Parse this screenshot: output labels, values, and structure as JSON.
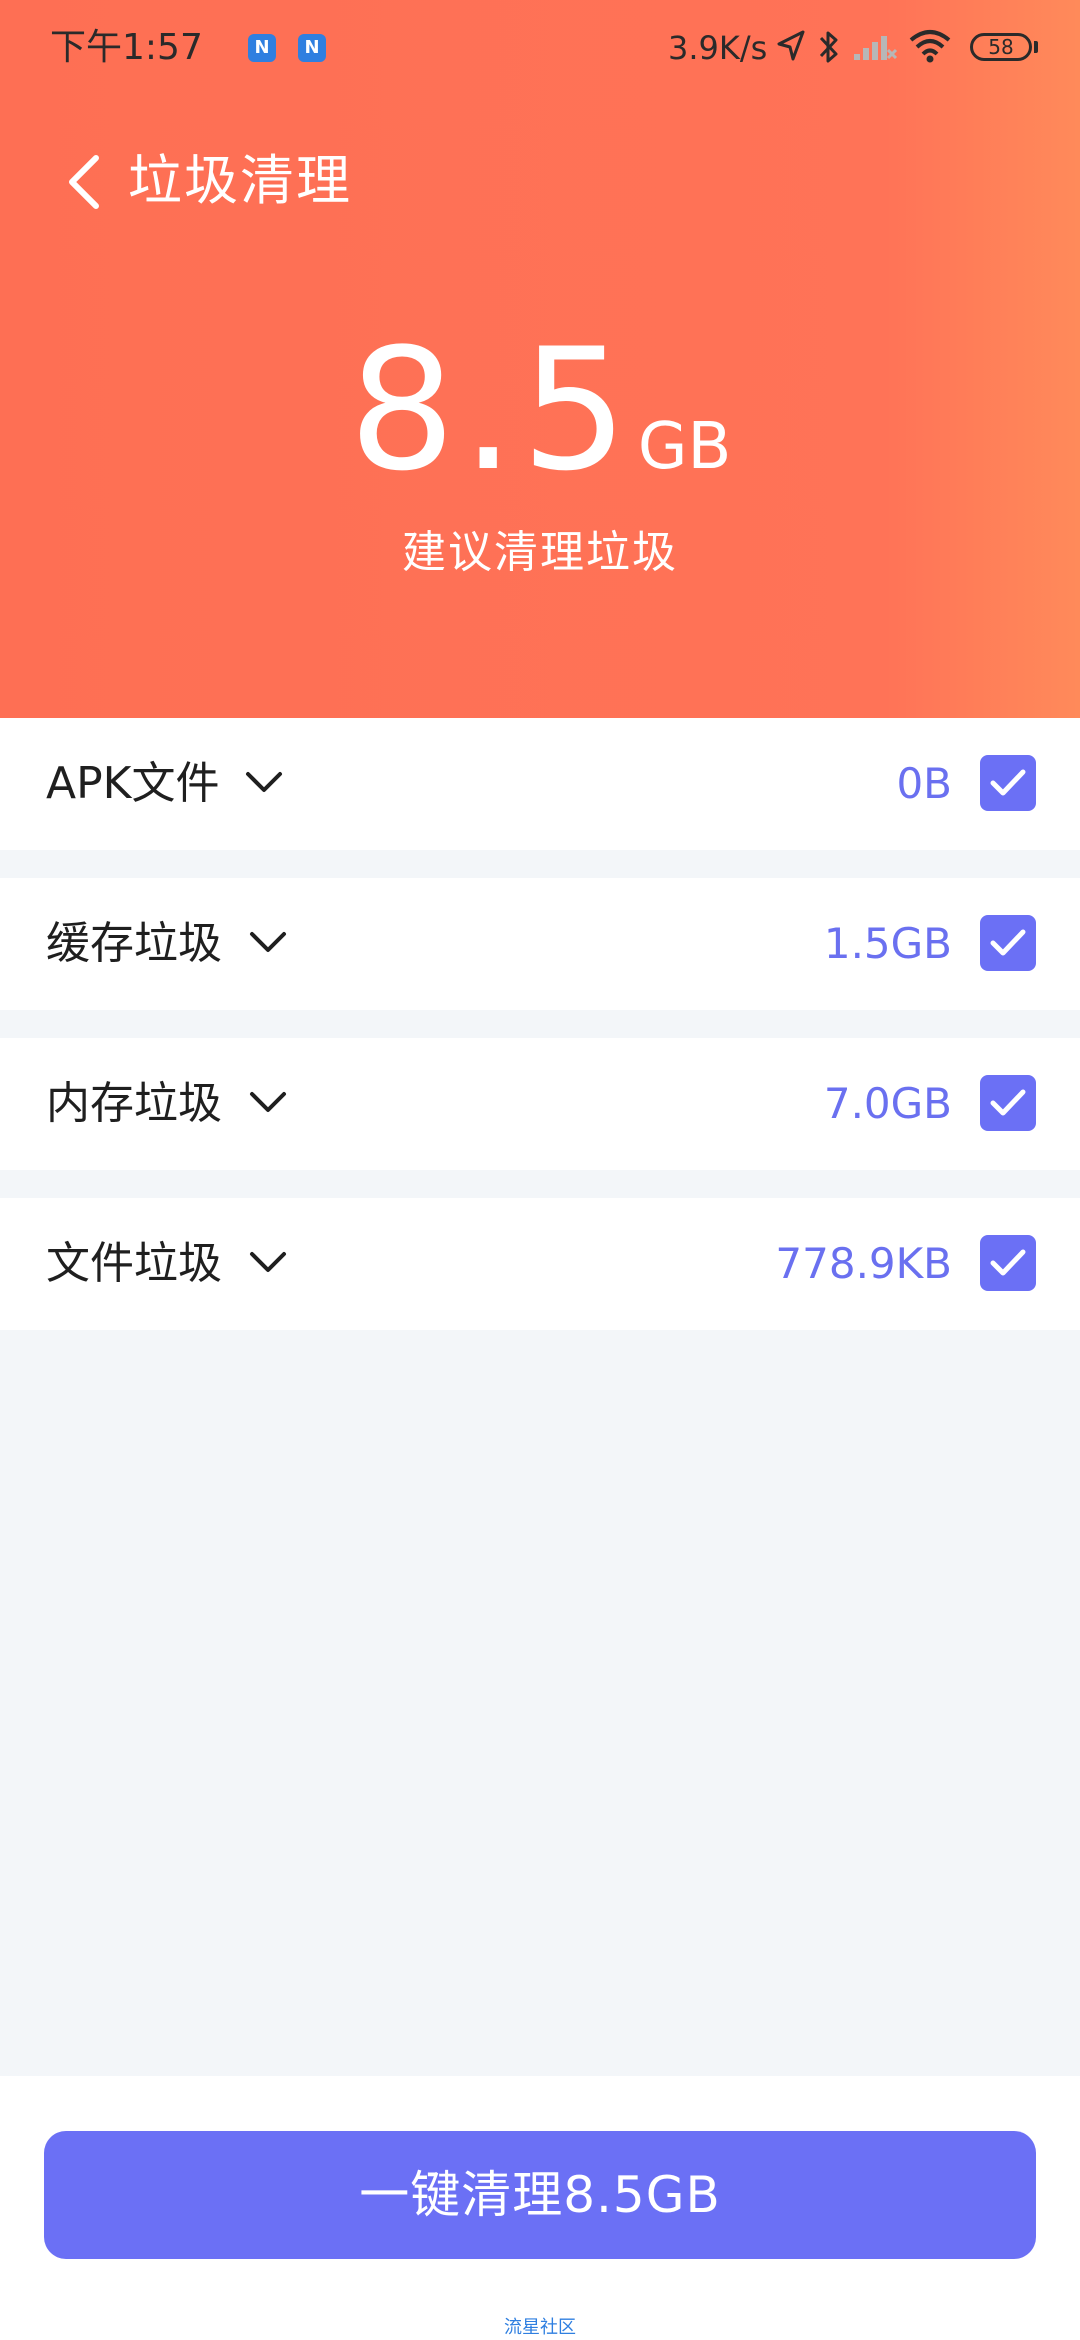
{
  "status_bar": {
    "time": "下午1:57",
    "notification_icons": [
      "N",
      "N"
    ],
    "network_speed": "3.9K/s",
    "battery": "58"
  },
  "header": {
    "title": "垃圾清理",
    "total_value": "8.5",
    "total_unit": "GB",
    "hint": "建议清理垃圾",
    "background_color": "#fe6f54"
  },
  "items": [
    {
      "label": "APK文件",
      "size": "0B",
      "checked": true
    },
    {
      "label": "缓存垃圾",
      "size": "1.5GB",
      "checked": true
    },
    {
      "label": "内存垃圾",
      "size": "7.0GB",
      "checked": true
    },
    {
      "label": "文件垃圾",
      "size": "778.9KB",
      "checked": true
    }
  ],
  "footer": {
    "clean_button_label": "一键清理8.5GB",
    "watermark": "流星社区"
  },
  "colors": {
    "accent": "#6b70f5",
    "size_text": "#6a70f0",
    "page_background": "#f3f6f9"
  },
  "icons": {
    "back": "chevron-left-icon",
    "expand": "chevron-down-icon",
    "check": "check-icon"
  }
}
